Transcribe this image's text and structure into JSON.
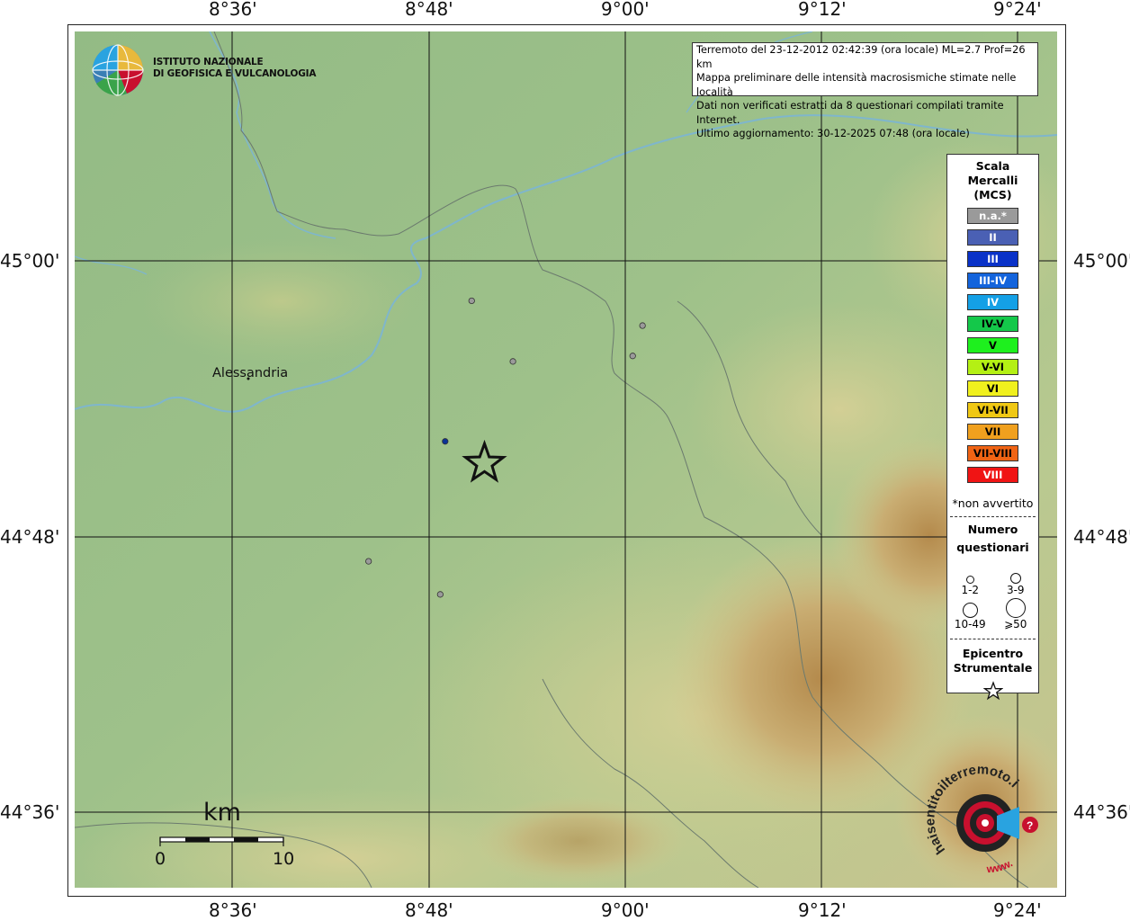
{
  "header": {
    "logo_line1": "ISTITUTO NAZIONALE",
    "logo_line2": "DI GEOFISICA E VULCANOLOGIA"
  },
  "info": {
    "line1": "Terremoto del 23-12-2012 02:42:39 (ora locale) ML=2.7 Prof=26 km",
    "line2": "Mappa preliminare delle intensità macrosismiche stimate nelle località",
    "line3": "Dati non verificati estratti da 8 questionari compilati tramite Internet.",
    "line4": "Ultimo aggiornamento: 30-12-2025 07:48 (ora locale)"
  },
  "axes": {
    "lon_ticks": [
      "8°36'",
      "8°48'",
      "9°00'",
      "9°12'",
      "9°24'"
    ],
    "lat_ticks": [
      "45°00'",
      "44°48'",
      "44°36'"
    ]
  },
  "map": {
    "city": "Alessandria",
    "scale_unit": "km",
    "scale_min": "0",
    "scale_max": "10",
    "watermark_text": "haisentitoilterremoto.it",
    "watermark_www": "www."
  },
  "legend": {
    "title1": "Scala",
    "title2": "Mercalli",
    "title3": "(MCS)",
    "levels": [
      {
        "label": "n.a.*",
        "color": "#9a9a9a",
        "text": "#ffffff"
      },
      {
        "label": "II",
        "color": "#4a60b4",
        "text": "#ffffff"
      },
      {
        "label": "III",
        "color": "#0a32c8",
        "text": "#ffffff"
      },
      {
        "label": "III-IV",
        "color": "#1464dc",
        "text": "#ffffff"
      },
      {
        "label": "IV",
        "color": "#14a0e6",
        "text": "#ffffff"
      },
      {
        "label": "IV-V",
        "color": "#14c84a",
        "text": "#000000"
      },
      {
        "label": "V",
        "color": "#1ef01e",
        "text": "#000000"
      },
      {
        "label": "V-VI",
        "color": "#b4f014",
        "text": "#000000"
      },
      {
        "label": "VI",
        "color": "#f0f01e",
        "text": "#000000"
      },
      {
        "label": "VI-VII",
        "color": "#f0c814",
        "text": "#000000"
      },
      {
        "label": "VII",
        "color": "#f0a01e",
        "text": "#000000"
      },
      {
        "label": "VII-VIII",
        "color": "#f06414",
        "text": "#000000"
      },
      {
        "label": "VIII",
        "color": "#f01414",
        "text": "#ffffff"
      }
    ],
    "note": "*non avvertito",
    "questionnaire_title1": "Numero",
    "questionnaire_title2": "questionari",
    "size_labels": [
      "1-2",
      "3-9",
      "10-49",
      "⩾50"
    ],
    "epicenter_title1": "Epicentro",
    "epicenter_title2": "Strumentale"
  },
  "points": [
    {
      "lon": 8.844,
      "lat": 44.971,
      "intensity": "n.a.",
      "questionnaires": "1-2"
    },
    {
      "lon": 9.018,
      "lat": 44.953,
      "intensity": "n.a.",
      "questionnaires": "1-2"
    },
    {
      "lon": 8.886,
      "lat": 44.927,
      "intensity": "n.a.",
      "questionnaires": "1-2"
    },
    {
      "lon": 9.008,
      "lat": 44.931,
      "intensity": "n.a.",
      "questionnaires": "1-2"
    },
    {
      "lon": 8.817,
      "lat": 44.869,
      "intensity": "II",
      "questionnaires": "1-2"
    },
    {
      "lon": 8.739,
      "lat": 44.782,
      "intensity": "n.a.",
      "questionnaires": "1-2"
    },
    {
      "lon": 8.812,
      "lat": 44.758,
      "intensity": "n.a.",
      "questionnaires": "1-2"
    }
  ],
  "epicenter": {
    "lon": 8.857,
    "lat": 44.853
  }
}
